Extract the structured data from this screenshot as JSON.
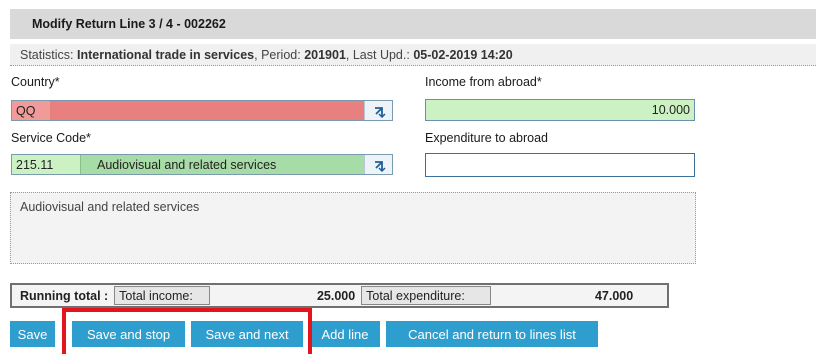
{
  "title": "Modify Return Line 3 / 4 - 002262",
  "stats": {
    "statistics_label": "Statistics:",
    "statistics_value": "International trade in services",
    "period_label": ", Period:",
    "period_value": "201901",
    "last_upd_label": ", Last Upd.:",
    "last_upd_value": "05-02-2019 14:20"
  },
  "form": {
    "country_label": "Country*",
    "country_value": "QQ",
    "income_label": "Income from abroad*",
    "income_value": "10.000",
    "service_code_label": "Service Code*",
    "service_code_value": "215.11",
    "service_code_desc": "Audiovisual and related services",
    "expenditure_label": "Expenditure to abroad",
    "expenditure_value": "",
    "description_text": "Audiovisual and related services"
  },
  "totals": {
    "running_total_label": "Running total :",
    "total_income_label": "Total income:",
    "total_income_value": "25.000",
    "total_expenditure_label": "Total expenditure:",
    "total_expenditure_value": "47.000"
  },
  "buttons": {
    "save": "Save",
    "save_and_stop": "Save and stop",
    "save_and_next": "Save and next",
    "add_line": "Add line",
    "cancel": "Cancel and return to lines list"
  },
  "icons": {
    "lookup": "lookup-arrow-icon"
  },
  "colors": {
    "title_bg": "#d9d9d9",
    "error_red": "#e88080",
    "valid_green": "#ccf2c4",
    "code_green": "#a8dca6",
    "button_blue": "#2e9ecf",
    "highlight_red": "#e3141b"
  }
}
